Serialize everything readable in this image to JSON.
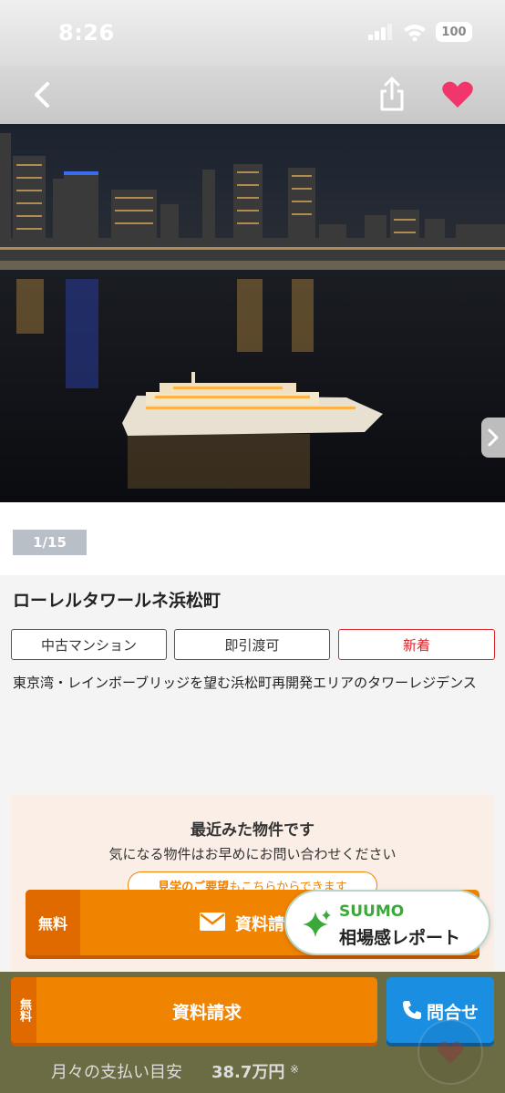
{
  "status_bar": {
    "time": "8:26",
    "battery": "100"
  },
  "nav": {
    "back_icon": "chevron-left-icon",
    "share_icon": "share-icon",
    "favorite_icon": "heart-icon",
    "favorite_color": "#f0366a"
  },
  "photo": {
    "counter": "1/15",
    "next_icon": "chevron-right-icon"
  },
  "property": {
    "title": "ローレルタワールネ浜松町",
    "tags": [
      "中古マンション",
      "即引渡可",
      "新着"
    ],
    "description": "東京湾・レインボーブリッジを望む浜松町再開発エリアのタワーレジデンス"
  },
  "recent": {
    "title": "最近みた物件です",
    "subtitle": "気になる物件はお早めにお問い合わせください",
    "visit_bold": "見学のご要望",
    "visit_rest": "もこちらからできます",
    "free": "無料",
    "request": "資料請求"
  },
  "suumo": {
    "brand": "SUUMO",
    "label": "相場感レポート"
  },
  "bottom": {
    "free": "無料",
    "request": "資料請求",
    "contact": "問合せ",
    "pay_label": "月々の支払い目安",
    "pay_value": "38.7万円",
    "pay_note": "※"
  },
  "colors": {
    "accent": "#f08300",
    "contact": "#1a8ee1",
    "new_tag": "#d9272e",
    "suumo_green": "#3aa93a"
  }
}
